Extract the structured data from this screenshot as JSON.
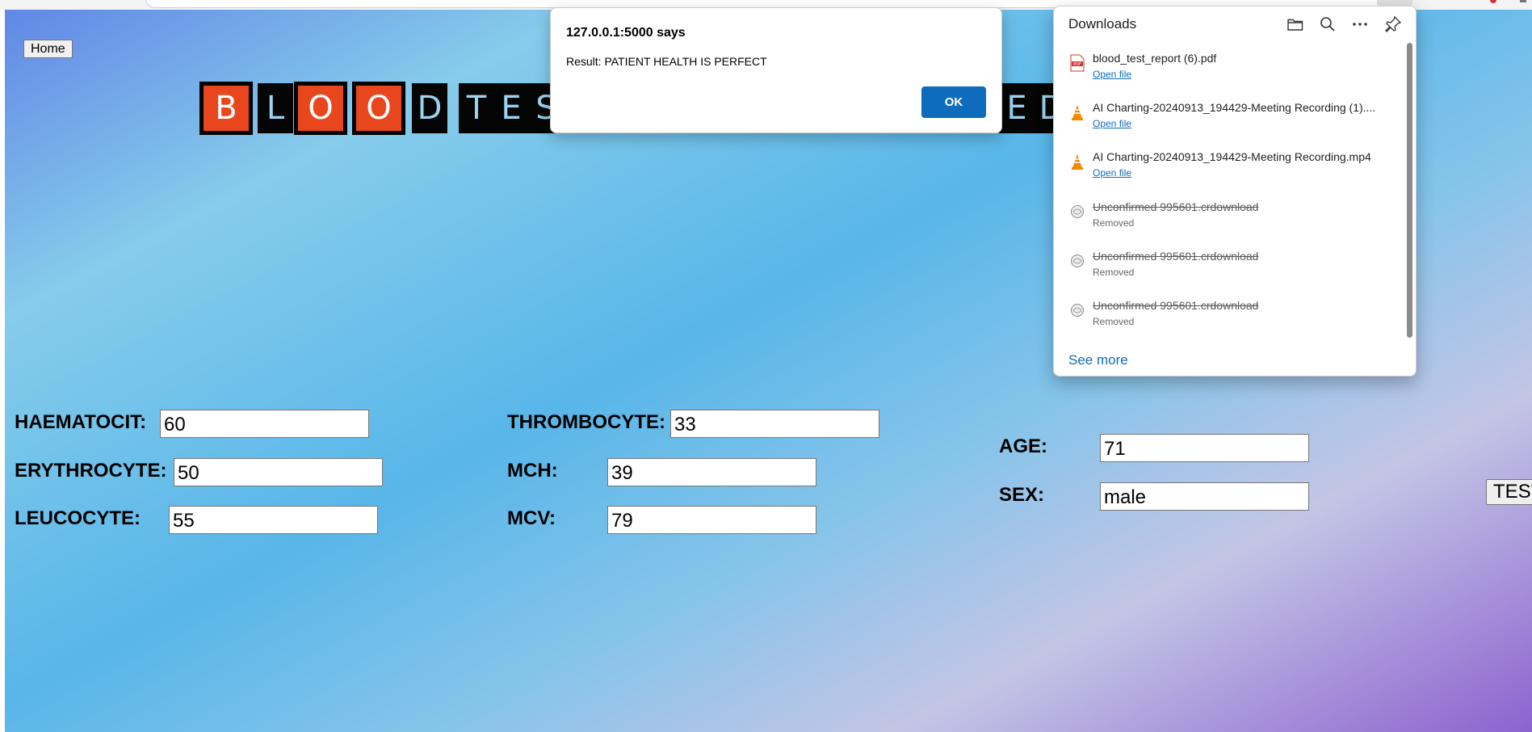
{
  "page": {
    "home_label": "Home",
    "logo_letters": [
      "B",
      "L",
      "O",
      "O",
      "D",
      "T",
      "E",
      "S",
      "E",
      "D"
    ],
    "logo_tile_colors": {
      "red": "#e8471e",
      "dark": "#050505",
      "letter_light": "#9cd3ee"
    },
    "form": {
      "haematocit": {
        "label": "HAEMATOCIT:",
        "value": "60"
      },
      "erythrocyte": {
        "label": "ERYTHROCYTE:",
        "value": "50"
      },
      "leucocyte": {
        "label": "LEUCOCYTE:",
        "value": "55"
      },
      "thrombocyte": {
        "label": "THROMBOCYTE:",
        "value": "33"
      },
      "mch": {
        "label": "MCH:",
        "value": "39"
      },
      "mcv": {
        "label": "MCV:",
        "value": "79"
      },
      "age": {
        "label": "AGE:",
        "value": "71"
      },
      "sex": {
        "label": "SEX:",
        "value": "male"
      }
    },
    "test_button_label": "TEST"
  },
  "alert": {
    "title": "127.0.0.1:5000 says",
    "message": "Result: PATIENT HEALTH IS PERFECT",
    "ok_label": "OK",
    "ok_color": "#0f6cbd"
  },
  "downloads": {
    "title": "Downloads",
    "header_icons": [
      "folder-icon",
      "search-icon",
      "more-icon",
      "pin-icon"
    ],
    "items": [
      {
        "name": "blood_test_report (6).pdf",
        "action": "Open file",
        "icon": "pdf-icon"
      },
      {
        "name": "AI Charting-20240913_194429-Meeting Recording (1)....",
        "action": "Open file",
        "icon": "vlc-icon"
      },
      {
        "name": "AI Charting-20240913_194429-Meeting Recording.mp4",
        "action": "Open file",
        "icon": "vlc-icon"
      },
      {
        "name": "Unconfirmed 995601.crdownload",
        "status": "Removed",
        "icon": "removed-file-icon"
      },
      {
        "name": "Unconfirmed 995601.crdownload",
        "status": "Removed",
        "icon": "removed-file-icon"
      },
      {
        "name": "Unconfirmed 995601.crdownload",
        "status": "Removed",
        "icon": "removed-file-icon"
      }
    ],
    "see_more": "See more"
  }
}
